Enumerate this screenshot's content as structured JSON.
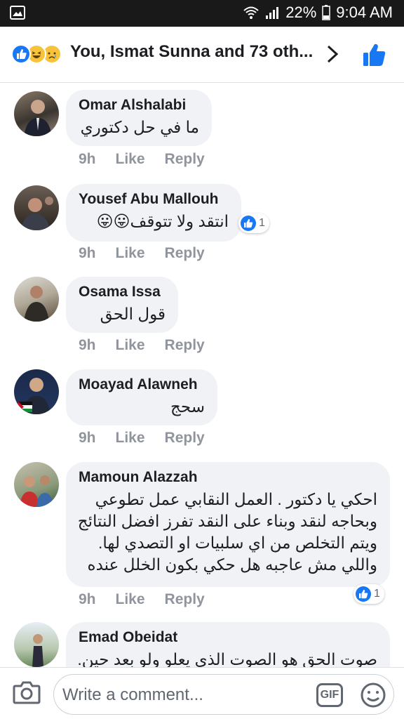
{
  "status_bar": {
    "battery": "22%",
    "time": "9:04 AM"
  },
  "header": {
    "title": "You, Ismat Sunna and 73 oth..."
  },
  "comments": [
    {
      "author": "Omar Alshalabi",
      "text": "ما في حل دكتوري",
      "time": "9h",
      "like": "Like",
      "reply": "Reply",
      "reactions": ""
    },
    {
      "author": "Yousef Abu Mallouh",
      "text": "انتقد ولا تتوقف😛😛",
      "time": "9h",
      "like": "Like",
      "reply": "Reply",
      "reactions": "1"
    },
    {
      "author": "Osama Issa",
      "text": "قول الحق",
      "time": "9h",
      "like": "Like",
      "reply": "Reply",
      "reactions": ""
    },
    {
      "author": "Moayad Alawneh",
      "text": "سحج",
      "time": "9h",
      "like": "Like",
      "reply": "Reply",
      "reactions": ""
    },
    {
      "author": "Mamoun Alazzah",
      "lines": [
        "احكي يا دكتور . العمل النقابي عمل تطوعي",
        "وبحاجه لنقد وبناء على النقد تفرز افضل النتائج",
        "ويتم التخلص من اي سلبيات  او التصدي لها.",
        "واللي مش عاجبه هل حكي بكون الخلل عنده"
      ],
      "time": "9h",
      "like": "Like",
      "reply": "Reply",
      "reactions": "1"
    },
    {
      "author": "Emad Obeidat",
      "text": "صوت الحق هو الصوت الذي يعلو ولو بعد حين.",
      "time": "",
      "like": "",
      "reply": "",
      "reactions": ""
    }
  ],
  "composer": {
    "placeholder": "Write a comment...",
    "gif_label": "GIF"
  },
  "colors": {
    "accent": "#1877f2",
    "bubble": "#f0f2f5",
    "meta": "#90949c"
  }
}
